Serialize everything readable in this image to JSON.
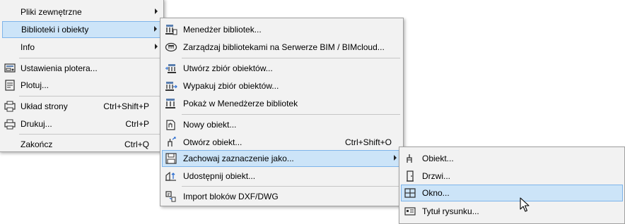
{
  "menu_file": {
    "items": [
      {
        "label": "Pliki zewnętrzne",
        "has_submenu": true
      },
      {
        "label": "Biblioteki i obiekty",
        "has_submenu": true,
        "highlighted": true
      },
      {
        "label": "Info",
        "has_submenu": true
      },
      {
        "label": "Ustawienia plotera...",
        "icon": "plotter-settings-icon"
      },
      {
        "label": "Plotuj...",
        "icon": "plot-icon"
      },
      {
        "label": "Układ strony",
        "shortcut": "Ctrl+Shift+P",
        "icon": "page-setup-icon"
      },
      {
        "label": "Drukuj...",
        "shortcut": "Ctrl+P",
        "icon": "print-icon"
      },
      {
        "label": "Zakończ",
        "shortcut": "Ctrl+Q"
      }
    ]
  },
  "menu_libraries": {
    "items": [
      {
        "label": "Menedżer bibliotek...",
        "icon": "library-manager-icon"
      },
      {
        "label": "Zarządzaj bibliotekami na Serwerze BIM / BIMcloud...",
        "icon": "bim-server-icon"
      },
      {
        "label": "Utwórz zbiór obiektów...",
        "icon": "create-container-icon"
      },
      {
        "label": "Wypakuj zbiór obiektów...",
        "icon": "extract-container-icon"
      },
      {
        "label": "Pokaż w Menedżerze bibliotek",
        "icon": "show-in-library-icon"
      },
      {
        "label": "Nowy obiekt...",
        "icon": "new-object-icon"
      },
      {
        "label": "Otwórz obiekt...",
        "shortcut": "Ctrl+Shift+O",
        "icon": "open-object-icon"
      },
      {
        "label": "Zachowaj zaznaczenie jako...",
        "has_submenu": true,
        "highlighted": true,
        "icon": "save-selection-icon"
      },
      {
        "label": "Udostępnij obiekt...",
        "icon": "share-object-icon"
      },
      {
        "label": "Import bloków DXF/DWG",
        "icon": "import-dxf-icon"
      }
    ]
  },
  "menu_save_as": {
    "items": [
      {
        "label": "Obiekt...",
        "icon": "object-icon"
      },
      {
        "label": "Drzwi...",
        "icon": "door-icon"
      },
      {
        "label": "Okno...",
        "highlighted": true,
        "icon": "window-icon"
      },
      {
        "label": "Tytuł rysunku...",
        "icon": "drawing-title-icon"
      }
    ]
  },
  "colors": {
    "menu_background": "#f2f2f2",
    "highlight_fill": "#cce4f8",
    "highlight_border": "#7eb4ea",
    "separator": "#c6c6c6"
  }
}
